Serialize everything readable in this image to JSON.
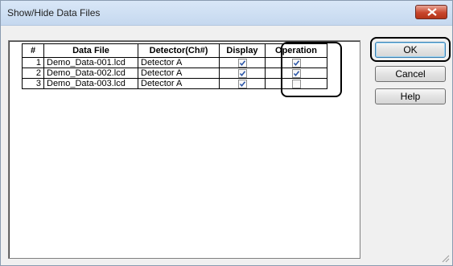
{
  "window": {
    "title": "Show/Hide Data Files"
  },
  "table": {
    "headers": {
      "num": "#",
      "file": "Data File",
      "detector": "Detector(Ch#)",
      "display": "Display",
      "operation": "Operation"
    },
    "rows": [
      {
        "num": "1",
        "file": "Demo_Data-001.lcd",
        "detector": "Detector A",
        "display": true,
        "operation": true
      },
      {
        "num": "2",
        "file": "Demo_Data-002.lcd",
        "detector": "Detector A",
        "display": true,
        "operation": true
      },
      {
        "num": "3",
        "file": "Demo_Data-003.lcd",
        "detector": "Detector A",
        "display": true,
        "operation": false
      }
    ]
  },
  "buttons": {
    "ok": "OK",
    "cancel": "Cancel",
    "help": "Help"
  }
}
